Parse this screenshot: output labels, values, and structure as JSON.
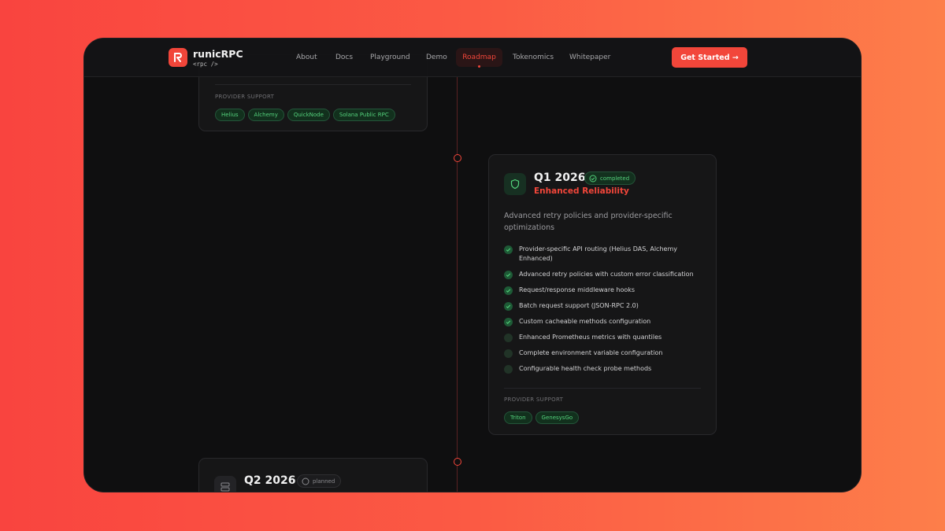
{
  "nav": {
    "brand": "runicRPC",
    "tagline": "<rpc />",
    "links": [
      "About",
      "Docs",
      "Playground",
      "Demo",
      "Roadmap",
      "Tokenomics",
      "Whitepaper"
    ],
    "active": "Roadmap",
    "cta": "Get Started →"
  },
  "prev_card": {
    "provider_label": "PROVIDER SUPPORT",
    "providers": [
      "Helius",
      "Alchemy",
      "QuickNode",
      "Solana Public RPC"
    ]
  },
  "q1": {
    "title": "Q1 2026",
    "status": "completed",
    "subtitle": "Enhanced Reliability",
    "description": "Advanced retry policies and provider-specific optimizations",
    "items": [
      {
        "text": "Provider-specific API routing (Helius DAS, Alchemy Enhanced)",
        "done": true
      },
      {
        "text": "Advanced retry policies with custom error classification",
        "done": true
      },
      {
        "text": "Request/response middleware hooks",
        "done": true
      },
      {
        "text": "Batch request support (JSON-RPC 2.0)",
        "done": true
      },
      {
        "text": "Custom cacheable methods configuration",
        "done": true
      },
      {
        "text": "Enhanced Prometheus metrics with quantiles",
        "done": false
      },
      {
        "text": "Complete environment variable configuration",
        "done": false
      },
      {
        "text": "Configurable health check probe methods",
        "done": false
      }
    ],
    "provider_label": "PROVIDER SUPPORT",
    "providers": [
      "Triton",
      "GenesysGo"
    ]
  },
  "q2": {
    "title": "Q2 2026",
    "status": "planned"
  },
  "colors": {
    "accent": "#f2463a",
    "success": "#54d27c",
    "background": "#0f0f10"
  }
}
